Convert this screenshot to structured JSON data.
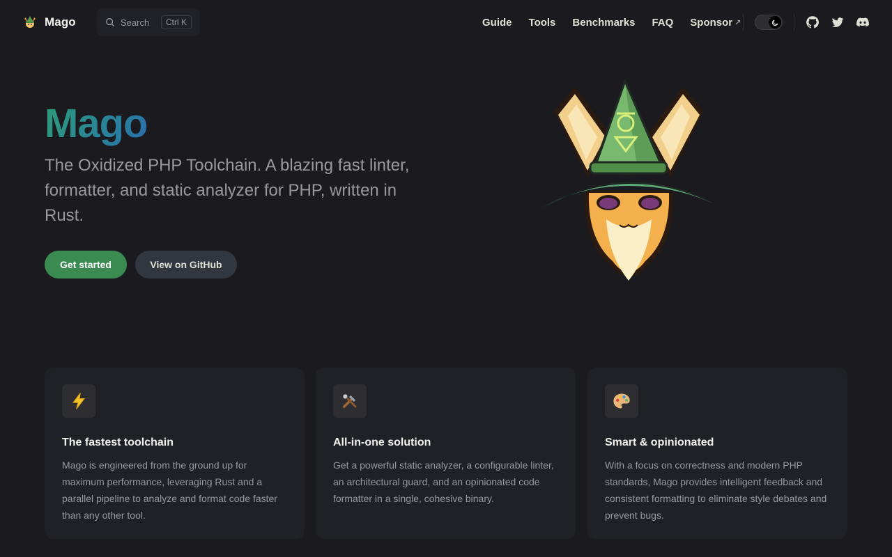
{
  "nav": {
    "brand": "Mago",
    "search": {
      "label": "Search",
      "shortcut": "Ctrl K"
    },
    "links": [
      {
        "label": "Guide"
      },
      {
        "label": "Tools"
      },
      {
        "label": "Benchmarks"
      },
      {
        "label": "FAQ"
      },
      {
        "label": "Sponsor",
        "external_arrow": "↗"
      }
    ],
    "theme_toggle": {
      "mode": "dark",
      "icon": "moon-icon"
    },
    "social": [
      "github-icon",
      "twitter-icon",
      "discord-icon"
    ]
  },
  "hero": {
    "name": "Mago",
    "tagline": "The Oxidized PHP Toolchain. A blazing fast linter, formatter, and static analyzer for PHP, written in Rust.",
    "actions": [
      {
        "label": "Get started",
        "style": "primary"
      },
      {
        "label": "View on GitHub",
        "style": "secondary"
      }
    ]
  },
  "features": [
    {
      "icon": "lightning-icon",
      "title": "The fastest toolchain",
      "details": "Mago is engineered from the ground up for maximum performance, leveraging Rust and a parallel pipeline to analyze and format code faster than any other tool."
    },
    {
      "icon": "tools-icon",
      "title": "All-in-one solution",
      "details": "Get a powerful static analyzer, a configurable linter, an architectural guard, and an opinionated code formatter in a single, cohesive binary."
    },
    {
      "icon": "palette-icon",
      "title": "Smart & opinionated",
      "details": "With a focus on correctness and modern PHP standards, Mago provides intelligent feedback and consistent formatting to eliminate style debates and prevent bugs."
    }
  ],
  "colors": {
    "background": "#1b1b1f",
    "card": "#202127",
    "primary_button": "#3a8a52",
    "secondary_button": "#32363f",
    "hero_gradient_start": "#2c9d77",
    "hero_gradient_end": "#2a6aa8",
    "muted_text": "#98989f"
  }
}
